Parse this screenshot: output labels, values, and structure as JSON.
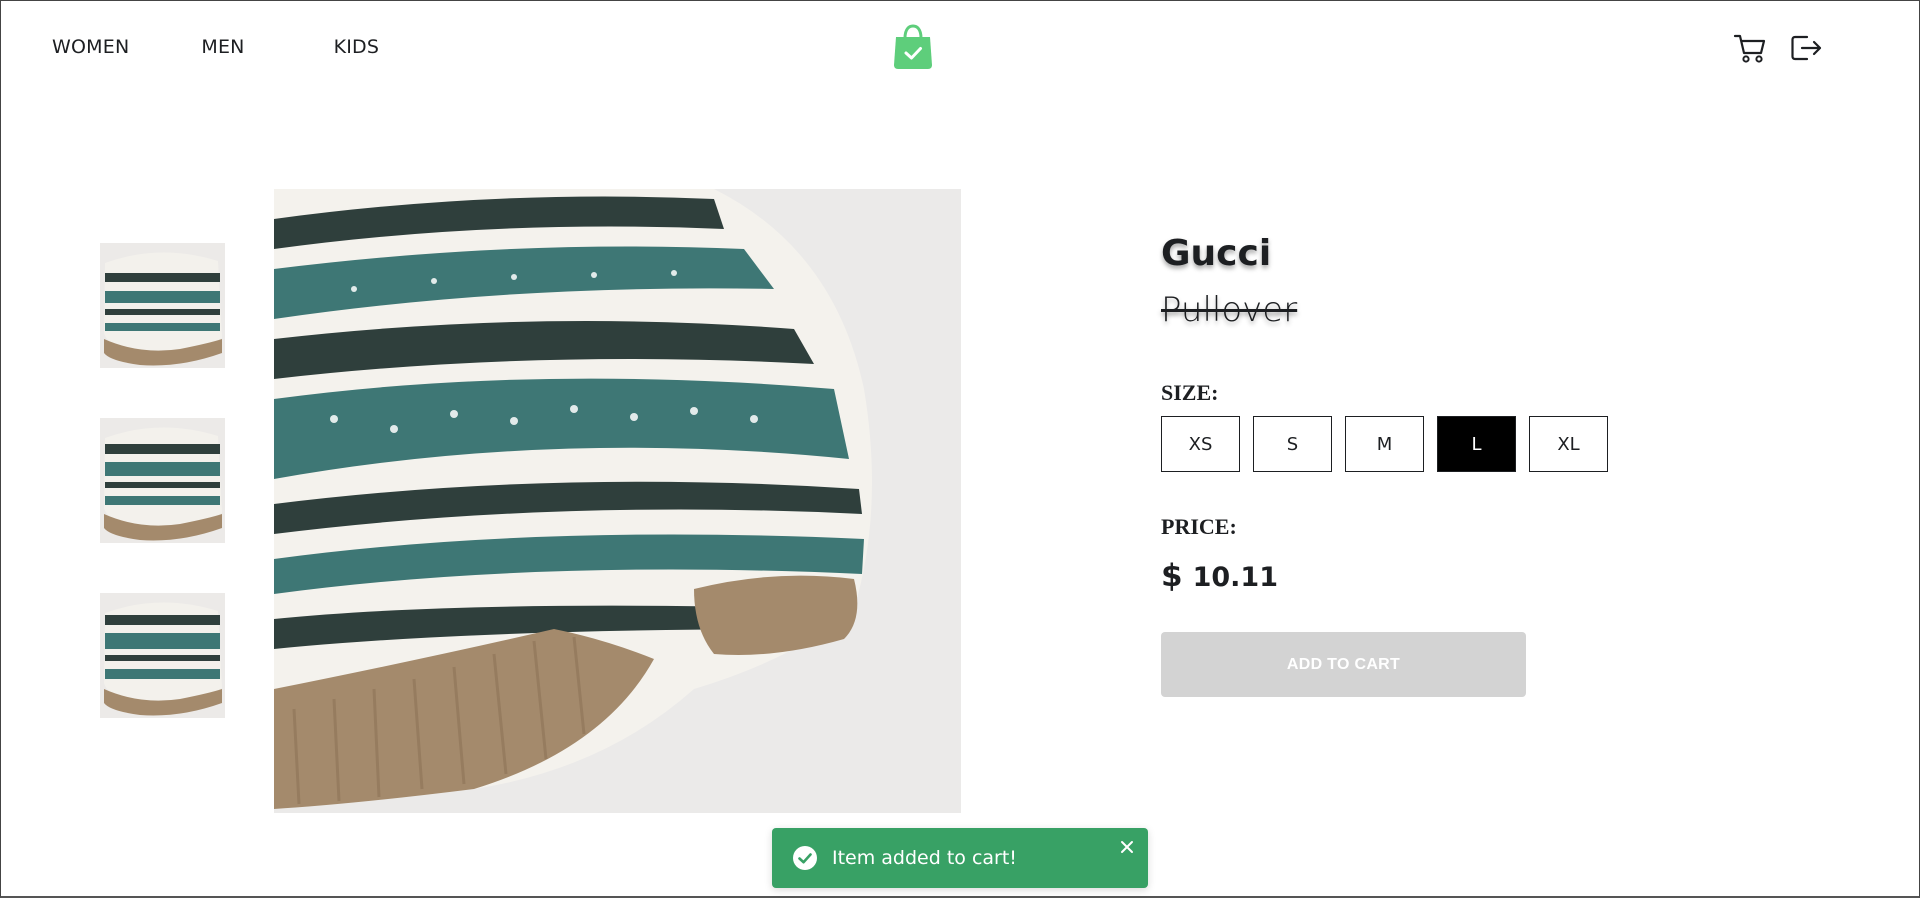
{
  "header": {
    "nav": [
      {
        "label": "WOMEN"
      },
      {
        "label": "MEN"
      },
      {
        "label": "KIDS"
      }
    ],
    "logo_icon": "shopping-bag-check-icon",
    "logo_color": "#5ece7b",
    "actions": [
      {
        "icon": "cart-icon"
      },
      {
        "icon": "logout-icon"
      }
    ]
  },
  "gallery": {
    "thumbnails": [
      "knit-sweater-thumbnail",
      "knit-sweater-thumbnail",
      "knit-sweater-thumbnail"
    ],
    "main_image": "knit-sweater-photo"
  },
  "product": {
    "brand": "Gucci",
    "name": "Pullover",
    "size_label": "SIZE:",
    "sizes": [
      {
        "label": "XS",
        "selected": false
      },
      {
        "label": "S",
        "selected": false
      },
      {
        "label": "M",
        "selected": false
      },
      {
        "label": "L",
        "selected": true
      },
      {
        "label": "XL",
        "selected": false
      }
    ],
    "price_label": "PRICE:",
    "price": {
      "currency": "$",
      "amount": "10.11"
    },
    "add_to_cart": "ADD TO CART"
  },
  "toast": {
    "message": "Item added to cart!",
    "icon": "check-circle-icon",
    "close_icon": "close-icon",
    "background": "#38a165"
  }
}
